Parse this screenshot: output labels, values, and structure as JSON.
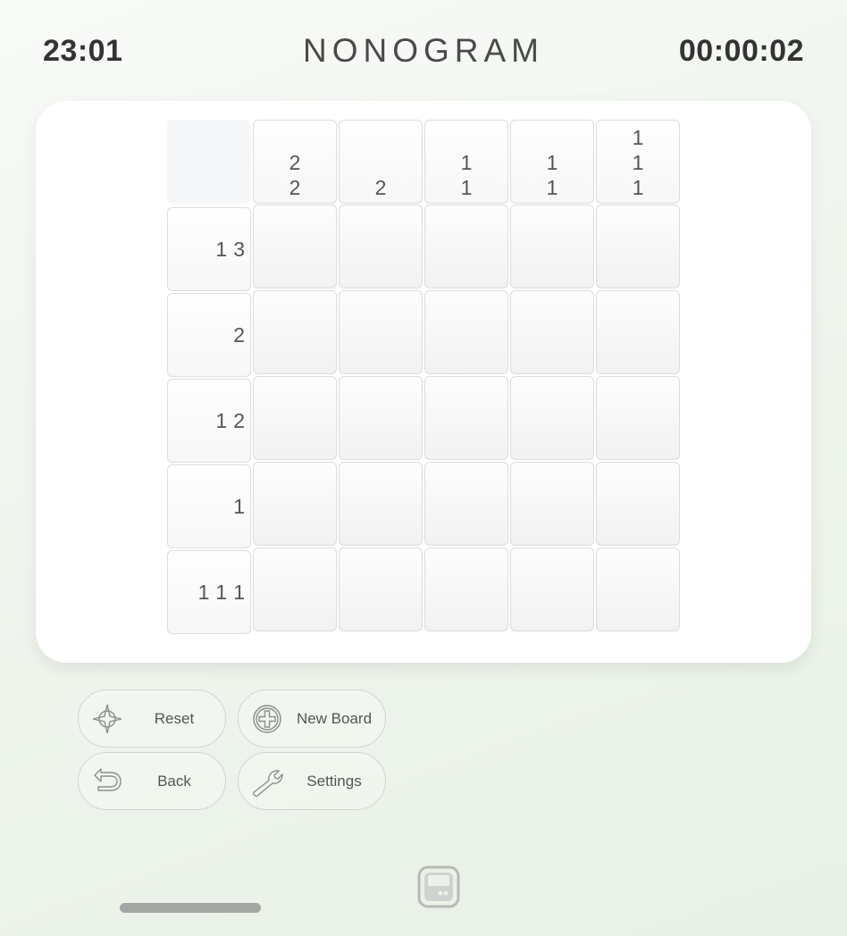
{
  "status": {
    "clock": "23:01",
    "title": "NONOGRAM",
    "timer": "00:00:02"
  },
  "puzzle": {
    "size": 5,
    "column_clues": [
      [
        "2",
        "2"
      ],
      [
        "2"
      ],
      [
        "1",
        "1"
      ],
      [
        "1",
        "1"
      ],
      [
        "1",
        "1",
        "1"
      ]
    ],
    "row_clues": [
      [
        "1",
        "3"
      ],
      [
        "2"
      ],
      [
        "1",
        "2"
      ],
      [
        "1"
      ],
      [
        "1",
        "1",
        "1"
      ]
    ],
    "cells": [
      [
        "empty",
        "empty",
        "empty",
        "empty",
        "empty"
      ],
      [
        "empty",
        "empty",
        "empty",
        "empty",
        "empty"
      ],
      [
        "empty",
        "empty",
        "empty",
        "empty",
        "empty"
      ],
      [
        "empty",
        "empty",
        "empty",
        "empty",
        "empty"
      ],
      [
        "empty",
        "empty",
        "empty",
        "empty",
        "empty"
      ]
    ]
  },
  "controls": {
    "reset": {
      "label": "Reset",
      "icon": "crosshair-compass-icon"
    },
    "new_board": {
      "label": "New Board",
      "icon": "plus-circle-icon"
    },
    "back": {
      "label": "Back",
      "icon": "undo-arrow-icon"
    },
    "settings": {
      "label": "Settings",
      "icon": "wrench-icon"
    }
  },
  "colors": {
    "icon_stroke": "#8a8f8a",
    "home_bar": "#a3a7a3"
  }
}
